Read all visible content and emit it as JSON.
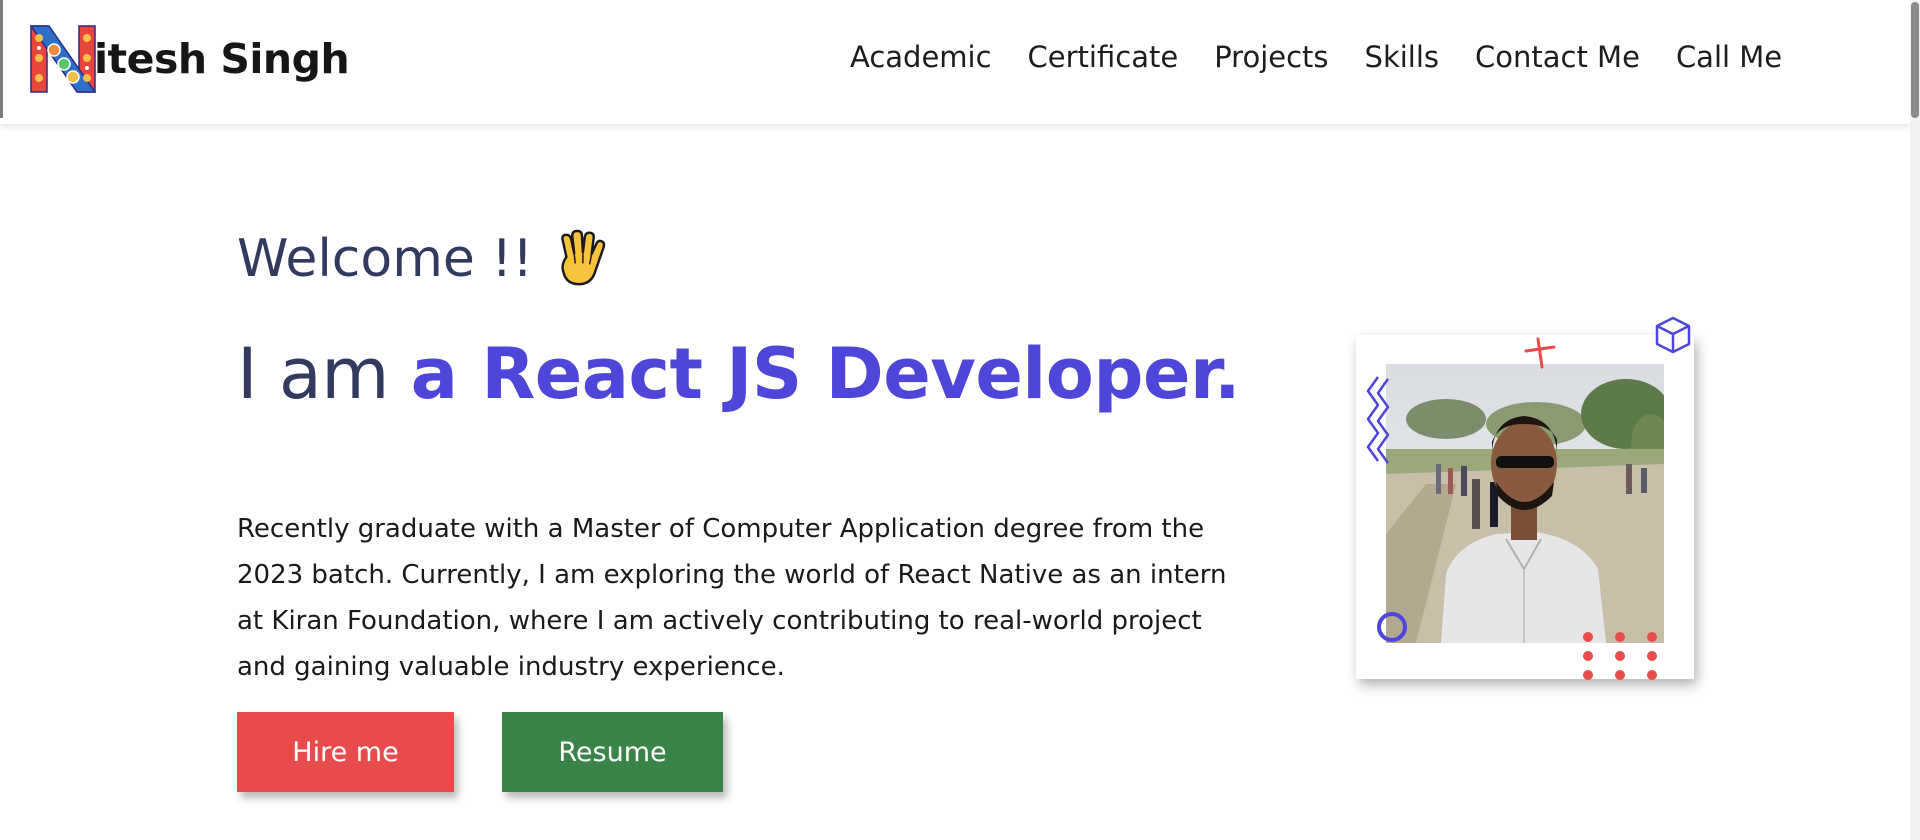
{
  "header": {
    "logo_text": "itesh Singh",
    "logo_letter": "N",
    "nav": [
      {
        "label": "Academic"
      },
      {
        "label": "Certificate"
      },
      {
        "label": "Projects"
      },
      {
        "label": "Skills"
      },
      {
        "label": "Contact Me"
      },
      {
        "label": "Call Me"
      }
    ]
  },
  "hero": {
    "welcome": "Welcome !!",
    "wave_icon": "waving-hand-icon",
    "headline_prefix": "I am ",
    "headline_accent": "a React JS Developer.",
    "intro": "Recently graduate with a Master of Computer Application degree from the 2023 batch. Currently, I am exploring the world of React Native as an intern at Kiran Foundation, where I am actively contributing to real-world project and gaining valuable industry experience.",
    "buttons": {
      "hire": "Hire me",
      "resume": "Resume"
    }
  },
  "colors": {
    "accent": "#4d46d8",
    "heading": "#333a60",
    "hire_button": "#e84b4b",
    "resume_button": "#3a8447"
  }
}
